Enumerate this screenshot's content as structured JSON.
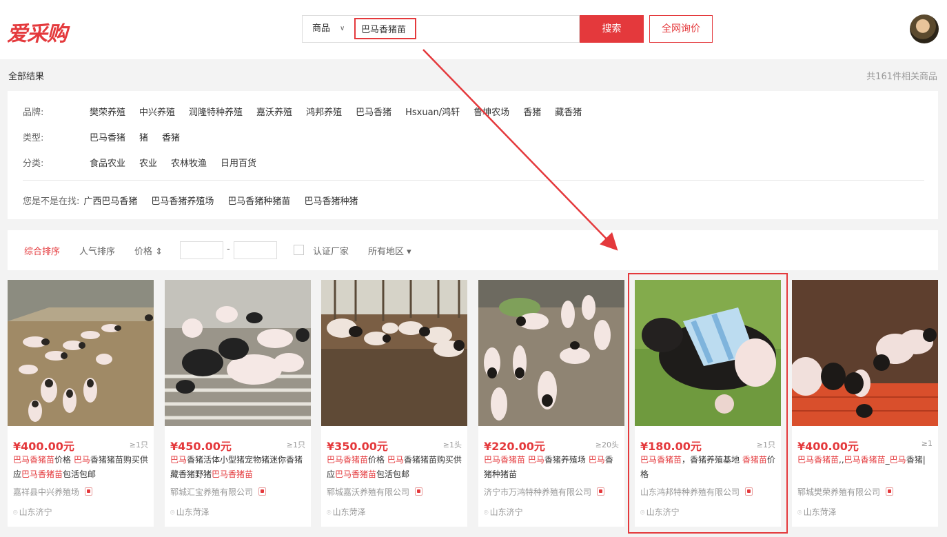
{
  "header": {
    "logo": "爱采购",
    "search_type": "商品",
    "search_value": "巴马香猪苗",
    "search_button": "搜索",
    "inquiry_button": "全网询价"
  },
  "results": {
    "all_label": "全部结果",
    "count_text": "共161件相关商品"
  },
  "filters": {
    "brand": {
      "label": "品牌:",
      "options": [
        "樊荣养殖",
        "中兴养殖",
        "润隆特种养殖",
        "嘉沃养殖",
        "鸿邦养殖",
        "巴马香猪",
        "Hsxuan/鸿轩",
        "鲁坤农场",
        "香猪",
        "藏香猪"
      ]
    },
    "type": {
      "label": "类型:",
      "options": [
        "巴马香猪",
        "猪",
        "香猪"
      ]
    },
    "category": {
      "label": "分类:",
      "options": [
        "食品农业",
        "农业",
        "农林牧渔",
        "日用百货"
      ]
    },
    "suggest": {
      "label": "您是不是在找:",
      "options": [
        "广西巴马香猪",
        "巴马香猪养殖场",
        "巴马香猪种猪苗",
        "巴马香猪种猪"
      ]
    }
  },
  "sort": {
    "comprehensive": "综合排序",
    "popularity": "人气排序",
    "price": "价格 ⇕",
    "dash": "-",
    "certified": "认证厂家",
    "region": "所有地区 ▾"
  },
  "products": [
    {
      "price": "¥400.00元",
      "qty": "≥1只",
      "title_parts": [
        [
          "巴马香猪苗",
          true
        ],
        [
          "价格 ",
          false
        ],
        [
          "巴马",
          true
        ],
        [
          "香猪猪苗购买供应",
          false
        ],
        [
          "巴马香猪苗",
          true
        ],
        [
          "包活包邮",
          false
        ]
      ],
      "company": "嘉祥县中兴养殖场",
      "location": "山东济宁"
    },
    {
      "price": "¥450.00元",
      "qty": "≥1只",
      "title_parts": [
        [
          "巴马",
          true
        ],
        [
          "香猪活体小型猪宠物猪迷你香猪藏香猪野猪",
          false
        ],
        [
          "巴马香猪苗",
          true
        ]
      ],
      "company": "郓城汇宝养殖有限公司",
      "location": "山东菏泽"
    },
    {
      "price": "¥350.00元",
      "qty": "≥1头",
      "title_parts": [
        [
          "巴马香猪苗",
          true
        ],
        [
          "价格 ",
          false
        ],
        [
          "巴马",
          true
        ],
        [
          "香猪猪苗购买供应",
          false
        ],
        [
          "巴马香猪苗",
          true
        ],
        [
          "包活包邮",
          false
        ]
      ],
      "company": "郓城嘉沃养殖有限公司",
      "location": "山东菏泽"
    },
    {
      "price": "¥220.00元",
      "qty": "≥20头",
      "title_parts": [
        [
          "巴马香猪苗",
          true
        ],
        [
          " ",
          false
        ],
        [
          "巴马",
          true
        ],
        [
          "香猪养殖场 ",
          false
        ],
        [
          "巴马",
          true
        ],
        [
          "香猪种猪苗",
          false
        ]
      ],
      "company": "济宁市万鸿特种养殖有限公司",
      "location": "山东济宁"
    },
    {
      "price": "¥180.00元",
      "qty": "≥1只",
      "title_parts": [
        [
          "巴马香猪苗",
          true
        ],
        [
          "，香猪养殖基地 ",
          false
        ],
        [
          "香猪苗",
          true
        ],
        [
          "价格",
          false
        ]
      ],
      "company": "山东鸿邦特种养殖有限公司",
      "location": "山东济宁"
    },
    {
      "price": "¥400.00元",
      "qty": "≥1",
      "title_parts": [
        [
          "巴马香猪苗",
          true
        ],
        [
          ",,",
          false
        ],
        [
          "巴马香猪苗",
          true
        ],
        [
          "_",
          false
        ],
        [
          "巴马",
          true
        ],
        [
          "香猪|",
          false
        ]
      ],
      "company": "郓城樊荣养殖有限公司",
      "location": "山东菏泽"
    }
  ]
}
